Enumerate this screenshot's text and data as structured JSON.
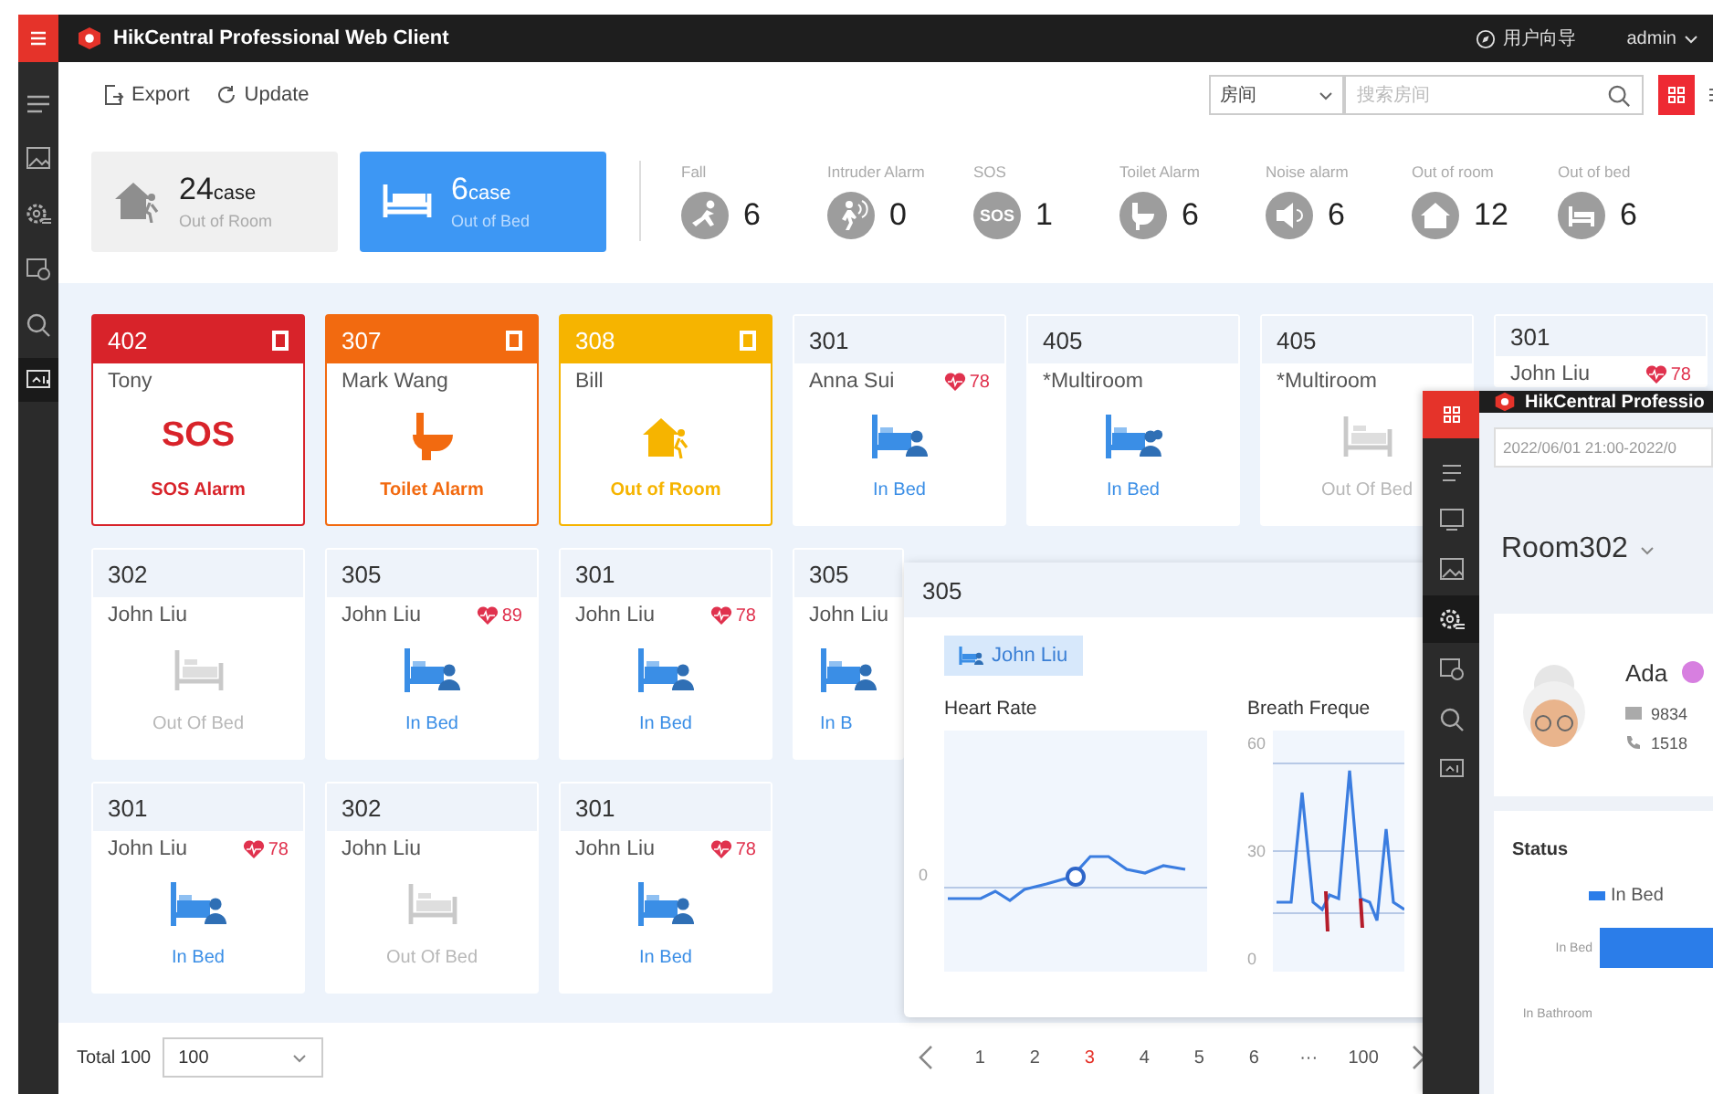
{
  "app": {
    "title": "HikCentral Professional Web Client",
    "guide": "用户向导",
    "user": "admin"
  },
  "toolbar": {
    "export": "Export",
    "update": "Update",
    "filter": "房间",
    "search": {
      "placeholder": "搜索房间"
    },
    "views": [
      {
        "kind": "grid",
        "selected": true
      },
      {
        "kind": "list",
        "selected": false
      }
    ]
  },
  "summary": [
    {
      "kind": "out_room",
      "count": "24",
      "unit": "case",
      "label": "Out of Room",
      "selected": false
    },
    {
      "kind": "out_bed",
      "count": "6",
      "unit": "case",
      "label": "Out of Bed",
      "selected": true
    }
  ],
  "alarms": [
    {
      "kind": "fall",
      "label": "Fall",
      "count": "6"
    },
    {
      "kind": "intruder",
      "label": "Intruder Alarm",
      "count": "0"
    },
    {
      "kind": "sos",
      "label": "SOS",
      "count": "1",
      "icon_text": "SOS"
    },
    {
      "kind": "toilet",
      "label": "Toilet Alarm",
      "count": "6"
    },
    {
      "kind": "noise",
      "label": "Noise alarm",
      "count": "6"
    },
    {
      "kind": "out_room",
      "label": "Out of room",
      "count": "12"
    },
    {
      "kind": "out_bed",
      "label": "Out of bed",
      "count": "6"
    }
  ],
  "rows": [
    [
      {
        "room": "402",
        "name": "Tony",
        "color": "#d8232a",
        "kind": "sos",
        "alert_text": "SOS",
        "status": "SOS Alarm"
      },
      {
        "room": "307",
        "name": "Mark Wang",
        "color": "#f26a10",
        "kind": "toilet",
        "status": "Toilet Alarm"
      },
      {
        "room": "308",
        "name": "Bill",
        "color": "#f6b400",
        "kind": "out_room",
        "status": "Out of Room"
      },
      {
        "room": "301",
        "name": "Anna Sui",
        "heart": "78",
        "kind": "in_bed",
        "status": "In Bed"
      },
      {
        "room": "405",
        "name": "*Multiroom",
        "kind": "multi_in",
        "status": "In Bed"
      },
      {
        "room": "405",
        "name": "*Multiroom",
        "kind": "multi_out",
        "status": "Out Of Bed"
      },
      {
        "room": "301",
        "name": "John Liu",
        "heart": "78"
      }
    ],
    [
      {
        "room": "302",
        "name": "John Liu",
        "kind": "out_bed",
        "status": "Out Of Bed"
      },
      {
        "room": "305",
        "name": "John Liu",
        "heart": "89",
        "kind": "in_bed",
        "status": "In Bed"
      },
      {
        "room": "301",
        "name": "John Liu",
        "heart": "78",
        "kind": "in_bed",
        "status": "In Bed"
      },
      {
        "room": "305",
        "name": "John Liu",
        "kind": "in_bed",
        "status": "In B",
        "partial": true
      }
    ],
    [
      {
        "room": "301",
        "name": "John Liu",
        "heart": "78",
        "kind": "in_bed",
        "status": "In Bed"
      },
      {
        "room": "302",
        "name": "John Liu",
        "kind": "out_bed",
        "status": "Out Of Bed"
      },
      {
        "room": "301",
        "name": "John Liu",
        "heart": "78",
        "kind": "in_bed",
        "status": "In Bed"
      }
    ]
  ],
  "pagination": {
    "total": "Total 100",
    "page_size": "100",
    "pages": [
      {
        "label": "1",
        "selected": false
      },
      {
        "label": "2",
        "selected": false
      },
      {
        "label": "3",
        "selected": true
      },
      {
        "label": "4",
        "selected": false
      },
      {
        "label": "5",
        "selected": false
      },
      {
        "label": "6",
        "selected": false
      },
      {
        "label": "···",
        "selected": false
      },
      {
        "label": "100",
        "selected": false
      }
    ]
  },
  "popup": {
    "room": "305",
    "resident": "John Liu",
    "charts": [
      {
        "title": "Heart Rate",
        "ticks": [
          "0"
        ]
      },
      {
        "title": "Breath Freque",
        "ticks": [
          "60",
          "30",
          "0"
        ]
      }
    ]
  },
  "detail_window": {
    "title": "HikCentral Professio",
    "date_range": "2022/06/01 21:00-2022/0",
    "room": "Room302",
    "person": {
      "name": "Ada",
      "id": "9834",
      "phone": "1518"
    },
    "status": {
      "title": "Status",
      "legend": "In Bed",
      "rows": [
        "In Bed",
        "In Bathroom"
      ]
    }
  }
}
